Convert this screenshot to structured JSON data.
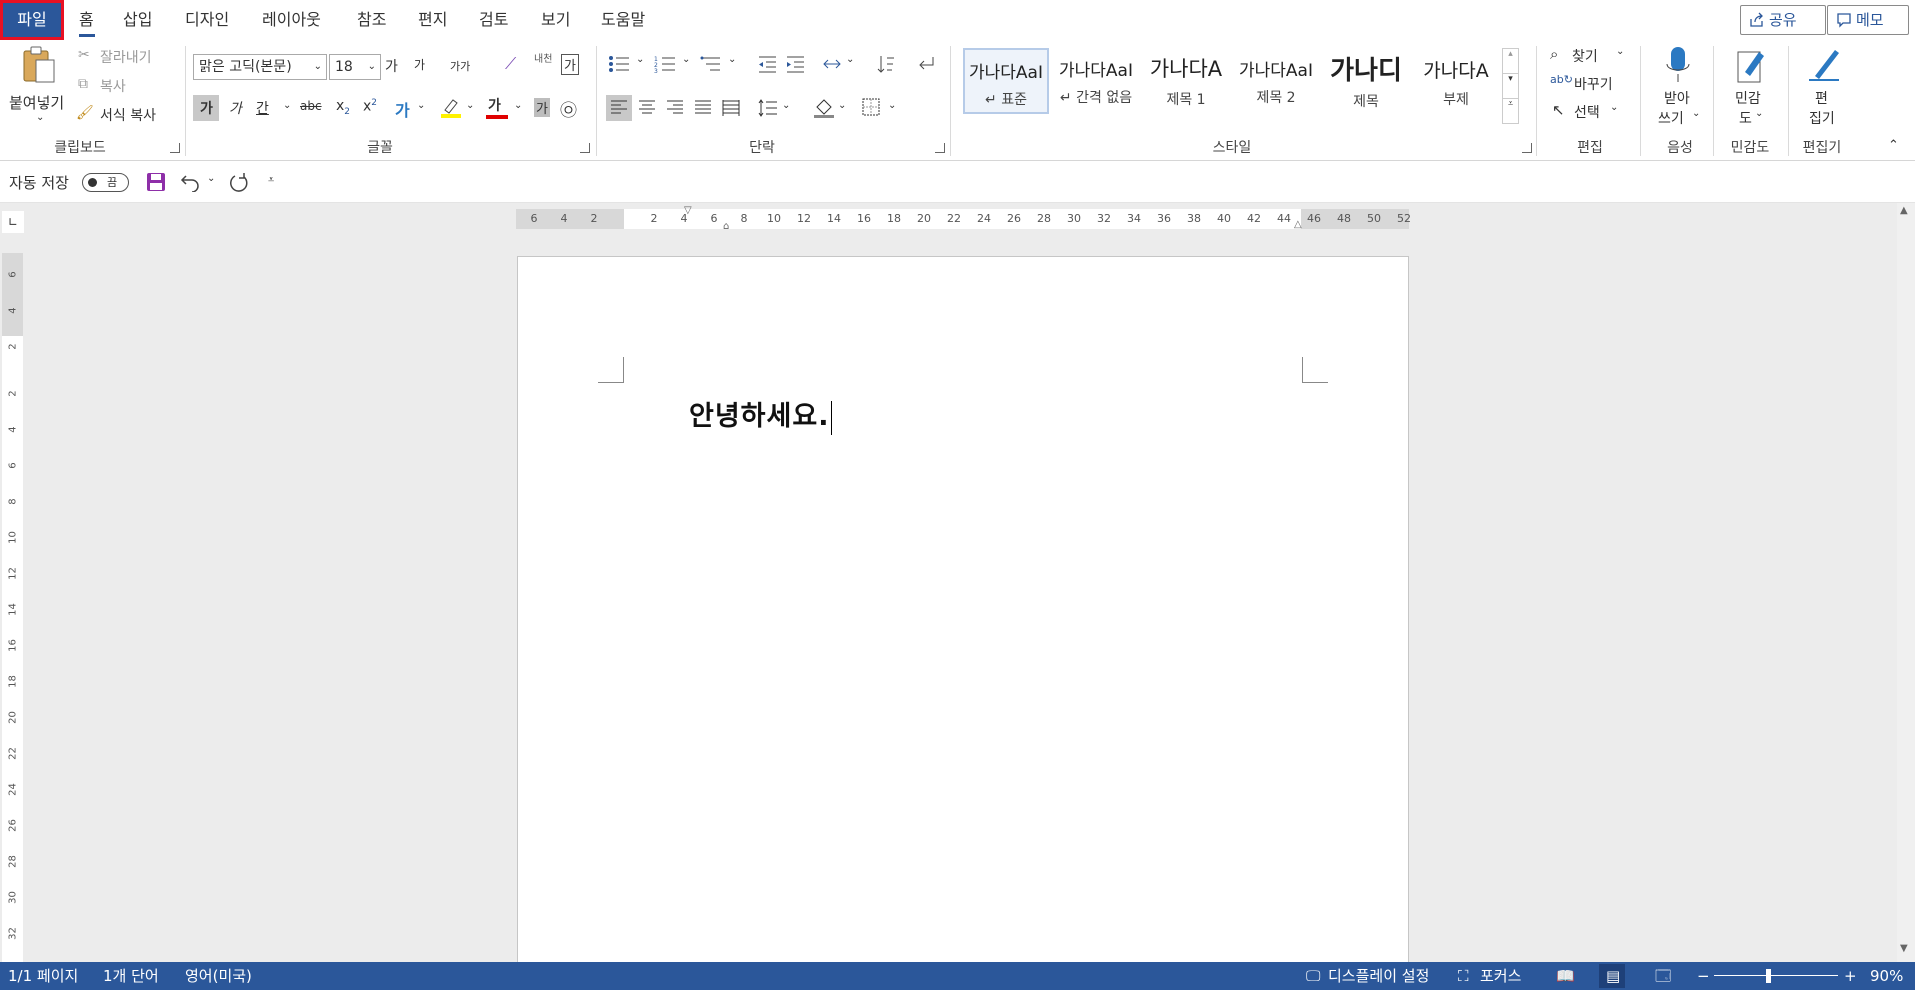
{
  "tabs": {
    "file": "파일",
    "home": "홈",
    "insert": "삽입",
    "design": "디자인",
    "layout": "레이아웃",
    "references": "참조",
    "mailings": "편지",
    "review": "검토",
    "view": "보기",
    "help": "도움말"
  },
  "top_buttons": {
    "share": "공유",
    "comments": "메모"
  },
  "clipboard": {
    "paste": "붙여넣기",
    "cut": "잘라내기",
    "copy": "복사",
    "format_painter": "서식 복사",
    "label": "클립보드"
  },
  "font": {
    "name": "맑은 고딕(본문)",
    "size": "18",
    "grow": "가",
    "shrink": "가",
    "case": "가가",
    "phonetic": "내천",
    "border_char": "가",
    "bold": "가",
    "italic": "가",
    "underline": "간",
    "strike": "abc",
    "sub": "x",
    "sub_mark": "2",
    "sup": "x",
    "sup_mark": "2",
    "effects": "가",
    "font_color": "가",
    "shade": "가",
    "enclose": "㉧",
    "label": "글꼴"
  },
  "paragraph": {
    "label": "단락"
  },
  "styles": {
    "items": [
      {
        "preview": "가나다AaI",
        "name": "↵ 표준"
      },
      {
        "preview": "가나다AaI",
        "name": "↵ 간격 없음"
      },
      {
        "preview": "가나다A",
        "name": "제목 1"
      },
      {
        "preview": "가나다AaI",
        "name": "제목 2"
      },
      {
        "preview": "가나디",
        "name": "제목"
      },
      {
        "preview": "가나다A",
        "name": "부제"
      }
    ],
    "label": "스타일"
  },
  "editing": {
    "find": "찾기",
    "replace": "바꾸기",
    "select": "선택",
    "label": "편집"
  },
  "voice": {
    "dictate1": "받아",
    "dictate2": "쓰기",
    "label": "음성"
  },
  "sensitivity": {
    "name1": "민감",
    "name2": "도",
    "label": "민감도"
  },
  "editor": {
    "name1": "편",
    "name2": "집기",
    "label": "편집기"
  },
  "qat": {
    "autosave": "자동 저장",
    "toggle": "끔"
  },
  "ruler": {
    "h_left": [
      "6",
      "4",
      "2"
    ],
    "h_main": [
      "2",
      "4",
      "6",
      "8",
      "10",
      "12",
      "14",
      "16",
      "18",
      "20",
      "22",
      "24",
      "26",
      "28",
      "30",
      "32",
      "34",
      "36",
      "38",
      "40",
      "42",
      "44",
      "46",
      "48",
      "50",
      "52"
    ],
    "v_top": [
      "6",
      "4",
      "2"
    ],
    "v_main": [
      "2",
      "4",
      "6",
      "8",
      "10",
      "12",
      "14",
      "16",
      "18",
      "20",
      "22",
      "24",
      "26",
      "28",
      "30",
      "32"
    ]
  },
  "document": {
    "text": "안녕하세요."
  },
  "status": {
    "page": "1/1 페이지",
    "words": "1개 단어",
    "language": "영어(미국)",
    "display": "디스플레이 설정",
    "focus": "포커스",
    "zoom": "90%"
  }
}
